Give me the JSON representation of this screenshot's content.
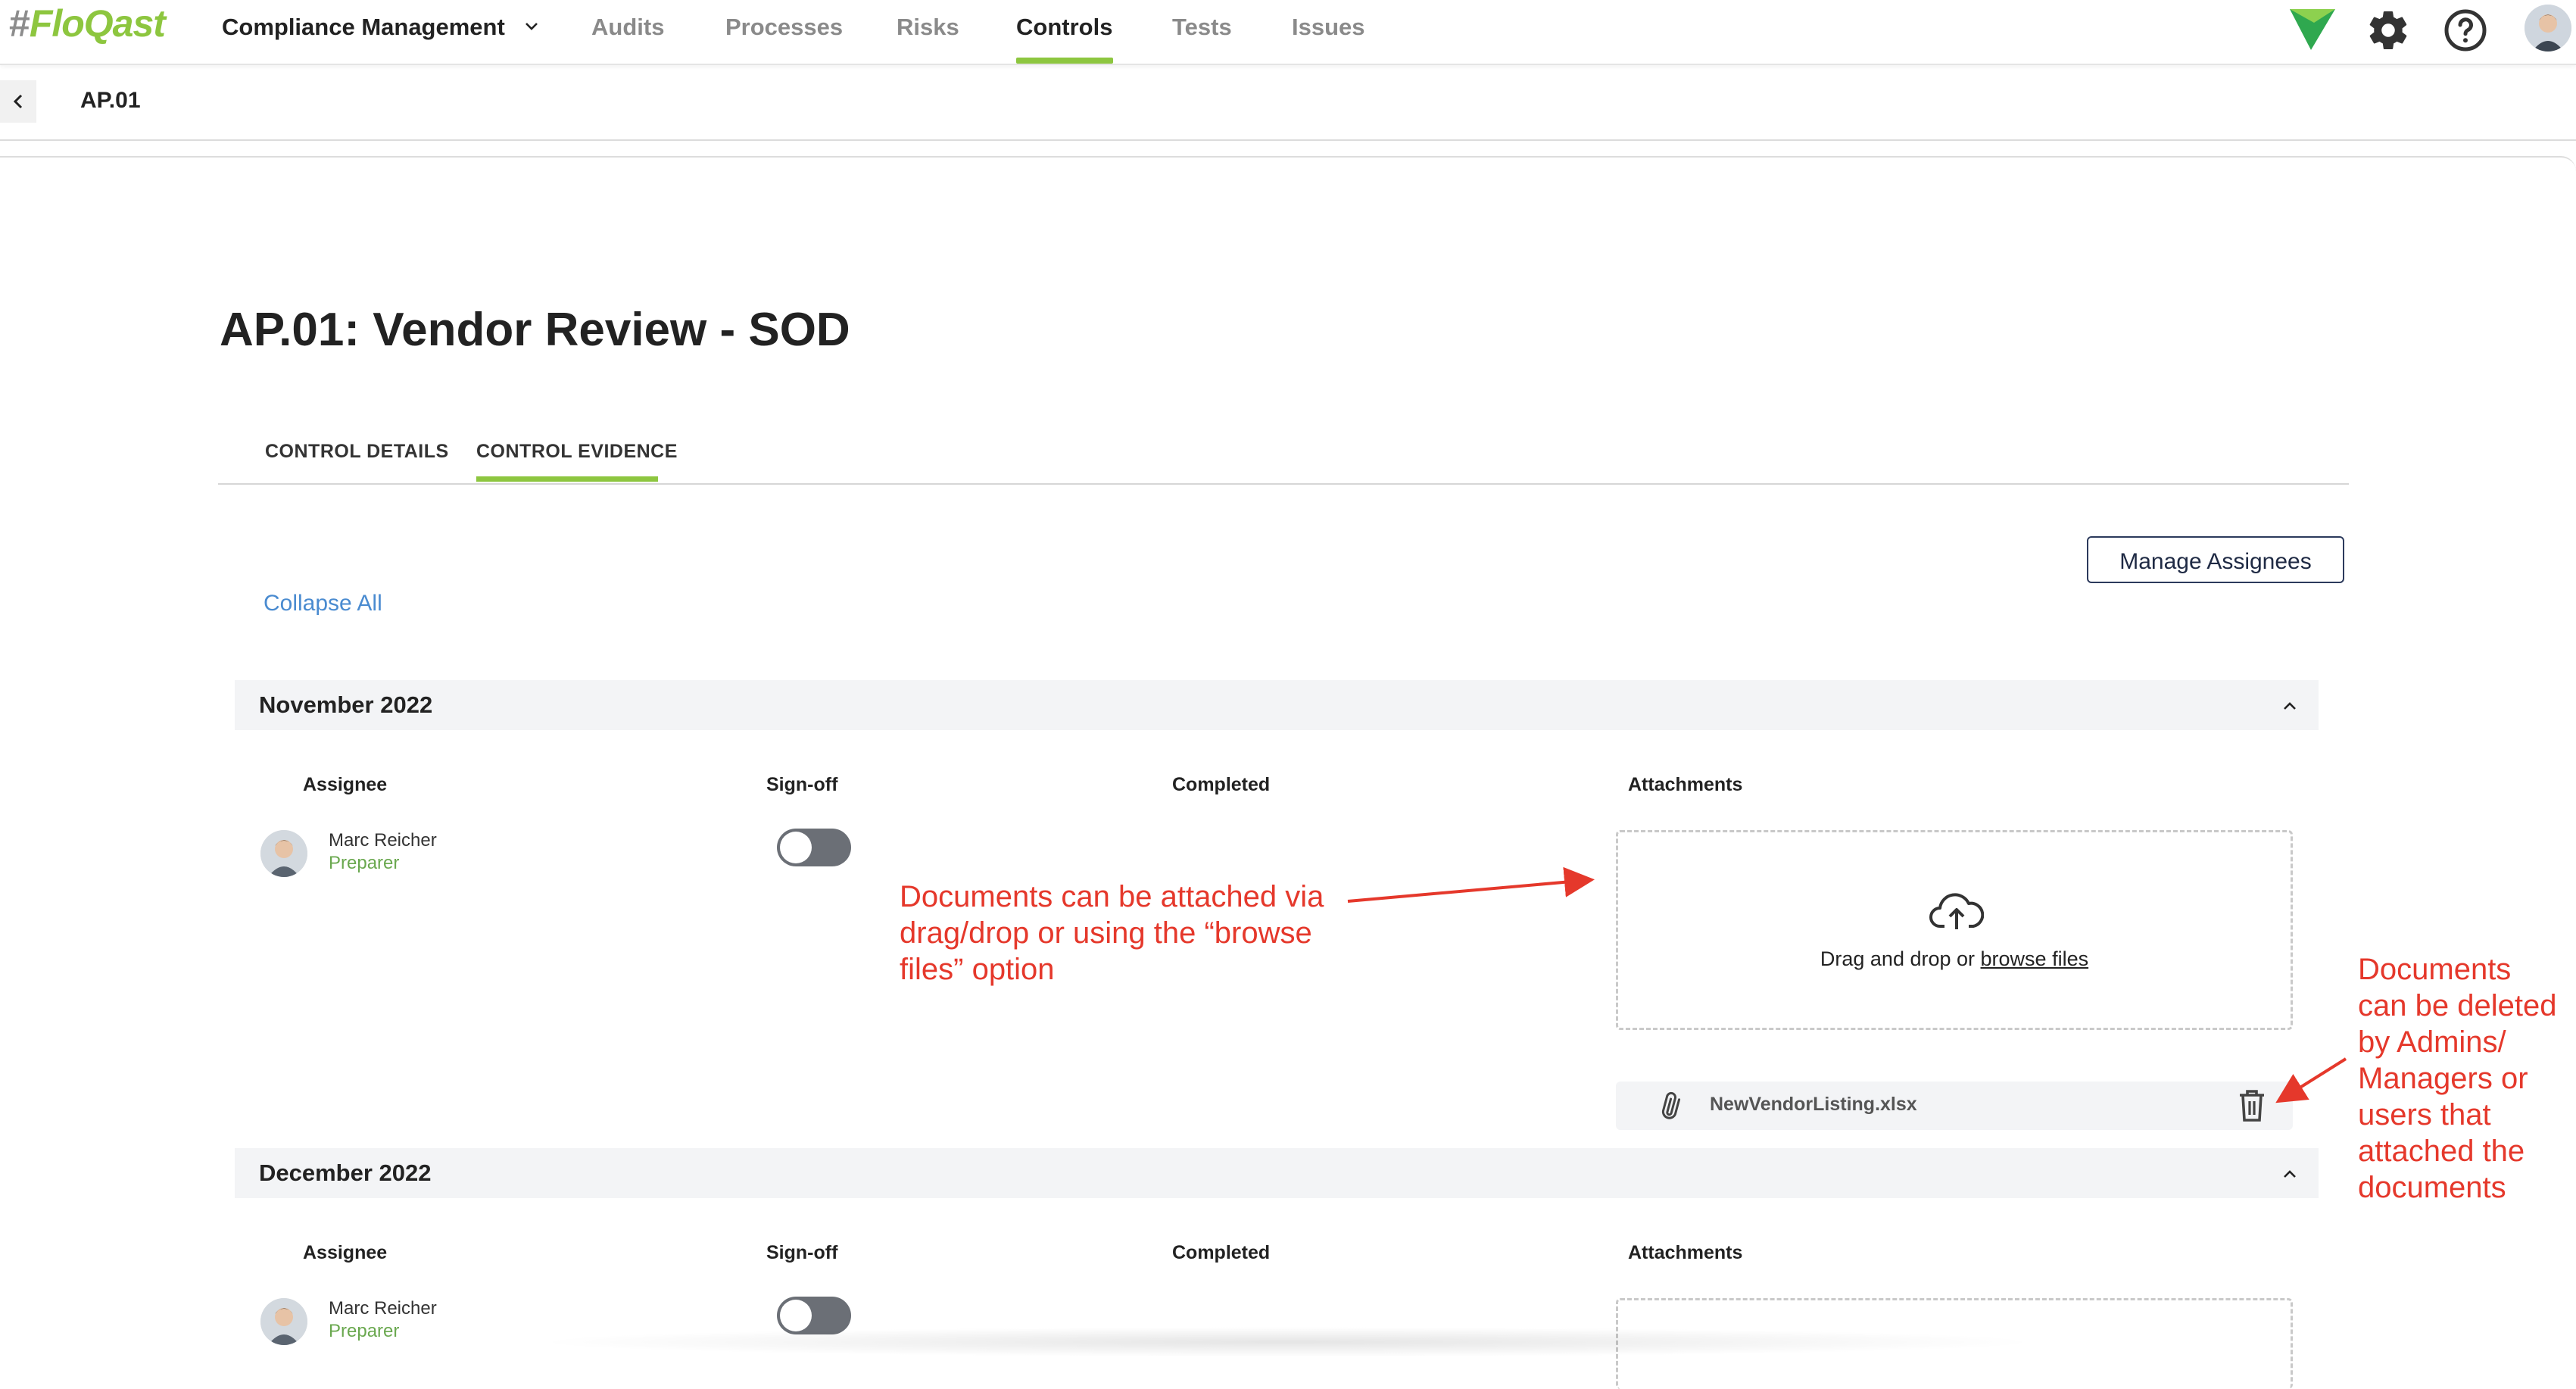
{
  "app": {
    "logo_hash": "#",
    "logo_text": "FloQast"
  },
  "nav": {
    "module": "Compliance Management",
    "items": [
      "Audits",
      "Processes",
      "Risks",
      "Controls",
      "Tests",
      "Issues"
    ],
    "active": "Controls"
  },
  "breadcrumb": {
    "title": "AP.01"
  },
  "page": {
    "title": "AP.01: Vendor Review - SOD",
    "tabs": [
      "CONTROL DETAILS",
      "CONTROL EVIDENCE"
    ],
    "active_tab": "CONTROL EVIDENCE",
    "manage_assignees": "Manage Assignees",
    "collapse_all": "Collapse All"
  },
  "columns": {
    "assignee": "Assignee",
    "signoff": "Sign-off",
    "completed": "Completed",
    "attachments": "Attachments"
  },
  "sections": [
    {
      "label": "November 2022",
      "assignee": {
        "name": "Marc Reicher",
        "role": "Preparer"
      },
      "signoff": false,
      "dropzone": {
        "text": "Drag and drop or",
        "link": "browse files"
      },
      "attachments": [
        "NewVendorListing.xlsx"
      ]
    },
    {
      "label": "December 2022",
      "assignee": {
        "name": "Marc Reicher",
        "role": "Preparer"
      },
      "signoff": false
    }
  ],
  "annotations": {
    "attach_note": [
      "Documents can be attached via",
      "drag/drop or using the “browse",
      "files” option"
    ],
    "delete_note": [
      "Documents",
      "can be deleted",
      "by Admins/",
      "Managers or",
      "users that",
      "attached the",
      "documents"
    ]
  },
  "colors": {
    "accent": "#8dc63f",
    "annotation": "#e5382b",
    "link": "#4a8bd0",
    "navy": "#2c3a5c"
  }
}
